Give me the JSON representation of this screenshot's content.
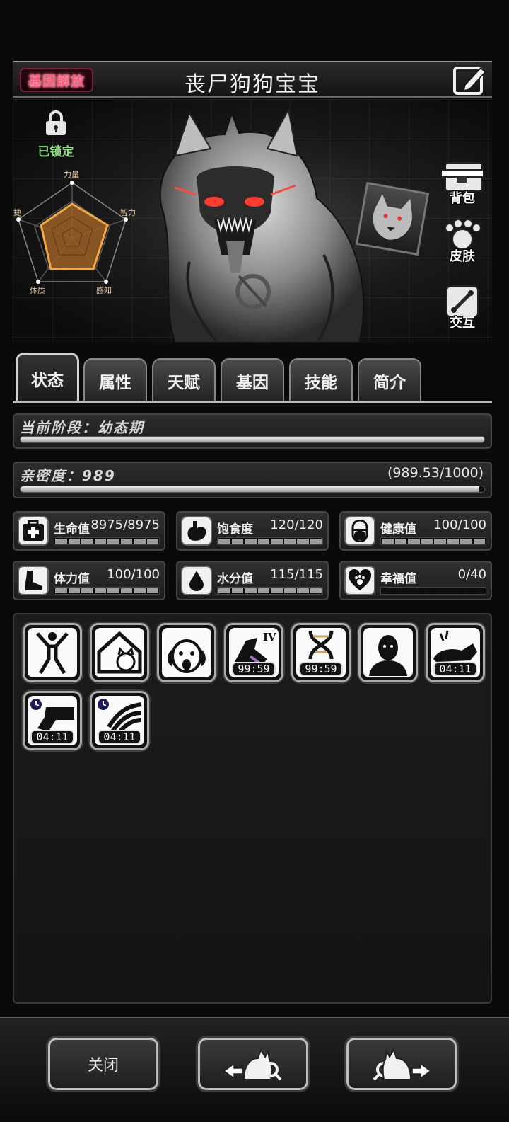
{
  "header": {
    "gene_badge": "基因解放",
    "title": "丧尸狗狗宝宝"
  },
  "lock": {
    "label": "已锁定"
  },
  "radar": {
    "axes": [
      "力量",
      "智力",
      "感知",
      "体质",
      "敏捷"
    ]
  },
  "side_buttons": [
    {
      "label": "背包",
      "icon": "backpack-icon"
    },
    {
      "label": "皮肤",
      "icon": "paw-icon"
    },
    {
      "label": "交互",
      "icon": "bone-bag-icon"
    }
  ],
  "tabs": [
    {
      "label": "状态",
      "active": true
    },
    {
      "label": "属性",
      "active": false
    },
    {
      "label": "天赋",
      "active": false
    },
    {
      "label": "基因",
      "active": false
    },
    {
      "label": "技能",
      "active": false
    },
    {
      "label": "简介",
      "active": false
    }
  ],
  "stage": {
    "label": "当前阶段：幼态期",
    "progress": 1.0
  },
  "intimacy": {
    "label": "亲密度：989",
    "detail": "(989.53/1000)",
    "progress": 0.9895
  },
  "stats": [
    {
      "name": "生命值",
      "value": "8975/8975",
      "icon": "first-aid-icon",
      "ratio": 1.0
    },
    {
      "name": "饱食度",
      "value": "120/120",
      "icon": "stomach-icon",
      "ratio": 1.0
    },
    {
      "name": "健康值",
      "value": "100/100",
      "icon": "pill-icon",
      "ratio": 1.0
    },
    {
      "name": "体力值",
      "value": "100/100",
      "icon": "foot-icon",
      "ratio": 1.0
    },
    {
      "name": "水分值",
      "value": "115/115",
      "icon": "water-drop-icon",
      "ratio": 1.0
    },
    {
      "name": "幸福值",
      "value": "0/40",
      "icon": "heart-paw-icon",
      "ratio": 0.0
    }
  ],
  "buffs": [
    {
      "icon": "stretch-figure-icon",
      "timer": ""
    },
    {
      "icon": "pet-house-icon",
      "timer": ""
    },
    {
      "icon": "scared-dog-icon",
      "timer": ""
    },
    {
      "icon": "muscle-arm-iv-icon",
      "timer": "99:59"
    },
    {
      "icon": "dna-icon",
      "timer": "99:59"
    },
    {
      "icon": "bald-head-icon",
      "timer": ""
    },
    {
      "icon": "dog-lying-icon",
      "timer": "04:11"
    },
    {
      "icon": "dash-clock-icon",
      "timer": "04:11"
    },
    {
      "icon": "claw-clock-icon",
      "timer": "04:11"
    }
  ],
  "footer": {
    "close_label": "关闭",
    "prev_icon": "prev-pet-icon",
    "next_icon": "next-pet-icon"
  }
}
